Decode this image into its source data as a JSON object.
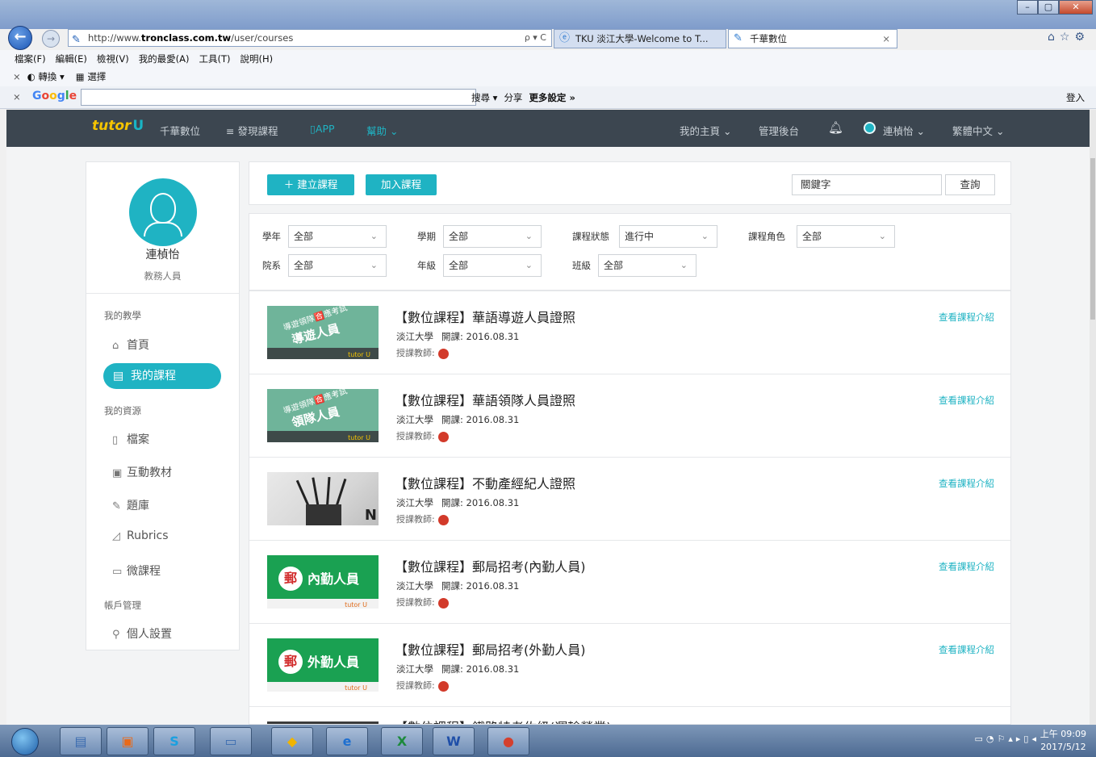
{
  "browser": {
    "address_prefix": "http://www.",
    "address_domain": "tronclass.com.tw",
    "address_path": "/user/courses",
    "address_tools": "ρ ▾ C",
    "tabs": [
      {
        "label": "TKU 淡江大學-Welcome to T..."
      },
      {
        "label": "千華數位"
      }
    ],
    "tab_close": "×",
    "menu": [
      "檔案(F)",
      "編輯(E)",
      "檢視(V)",
      "我的最愛(A)",
      "工具(T)",
      "說明(H)"
    ],
    "favorites": [
      "轉換",
      "選擇"
    ],
    "favorites_close": "×",
    "google_close": "×",
    "google_logo": "Google",
    "google_tools": [
      "搜尋 ▾",
      "分享",
      "更多設定 »"
    ],
    "google_login": "登入"
  },
  "header": {
    "brand": "tutor",
    "brand_u": "U",
    "nav_left": [
      "千華數位",
      "≡ 發現課程",
      "APP",
      "幫助 ⌄"
    ],
    "nav_right": [
      "我的主頁 ⌄",
      "管理後台",
      "連楨怡 ⌄",
      "繁體中文 ⌄"
    ]
  },
  "sidebar": {
    "name": "連楨怡",
    "role": "教務人員",
    "sections": [
      "我的教學",
      "我的資源",
      "帳戶管理"
    ],
    "items": [
      {
        "label": "首頁",
        "icon": "home-icon"
      },
      {
        "label": "我的課程",
        "icon": "course-icon"
      },
      {
        "label": "檔案",
        "icon": "file-icon"
      },
      {
        "label": "互動教材",
        "icon": "material-icon"
      },
      {
        "label": "題庫",
        "icon": "question-bank-icon"
      },
      {
        "label": "Rubrics",
        "icon": "rubrics-icon"
      },
      {
        "label": "微課程",
        "icon": "micro-course-icon"
      },
      {
        "label": "個人設置",
        "icon": "settings-icon"
      }
    ]
  },
  "toolbar": {
    "create_label": "＋ 建立課程",
    "join_label": "加入課程",
    "search_value": "關鍵字",
    "search_button": "查詢"
  },
  "filters": [
    {
      "label": "學年",
      "value": "全部"
    },
    {
      "label": "學期",
      "value": "全部"
    },
    {
      "label": "課程狀態",
      "value": "進行中"
    },
    {
      "label": "課程角色",
      "value": "全部"
    },
    {
      "label": "院系",
      "value": "全部"
    },
    {
      "label": "年級",
      "value": "全部"
    },
    {
      "label": "班級",
      "value": "全部"
    }
  ],
  "courses": [
    {
      "title": "【數位課程】華語導遊人員證照",
      "school": "淡江大學",
      "open_label": "開課:",
      "open_date": "2016.08.31",
      "teacher_label": "授課教師:",
      "link": "查看課程介紹",
      "thumb": {
        "line1": "導遊領隊🈴應考試",
        "line2": "導遊人員",
        "line3": "tutor U"
      }
    },
    {
      "title": "【數位課程】華語領隊人員證照",
      "school": "淡江大學",
      "open_label": "開課:",
      "open_date": "2016.08.31",
      "teacher_label": "授課教師:",
      "link": "查看課程介紹",
      "thumb": {
        "line1": "導遊領隊🈴應考試",
        "line2": "領隊人員",
        "line3": "tutor U"
      }
    },
    {
      "title": "【數位課程】不動產經紀人證照",
      "school": "淡江大學",
      "open_label": "開課:",
      "open_date": "2016.08.31",
      "teacher_label": "授課教師:",
      "link": "查看課程介紹",
      "thumb": {
        "mark": "N"
      }
    },
    {
      "title": "【數位課程】郵局招考(內勤人員)",
      "school": "淡江大學",
      "open_label": "開課:",
      "open_date": "2016.08.31",
      "teacher_label": "授課教師:",
      "link": "查看課程介紹",
      "thumb": {
        "seal": "郵",
        "label": "內勤人員",
        "brand": "tutor U"
      }
    },
    {
      "title": "【數位課程】郵局招考(外勤人員)",
      "school": "淡江大學",
      "open_label": "開課:",
      "open_date": "2016.08.31",
      "teacher_label": "授課教師:",
      "link": "查看課程介紹",
      "thumb": {
        "seal": "郵",
        "label": "外勤人員",
        "brand": "tutor U"
      }
    },
    {
      "title": "【數位課程】鐵路特考佐級(運輸營業)",
      "school": "",
      "open_label": "",
      "open_date": "",
      "teacher_label": "",
      "link": "",
      "thumb": {}
    }
  ],
  "taskbar": {
    "time": "上午 09:09",
    "date": "2017/5/12"
  },
  "colors": {
    "accent": "#1fb3c3",
    "header_bg": "#3c4650",
    "brand_yellow": "#f5c400"
  }
}
